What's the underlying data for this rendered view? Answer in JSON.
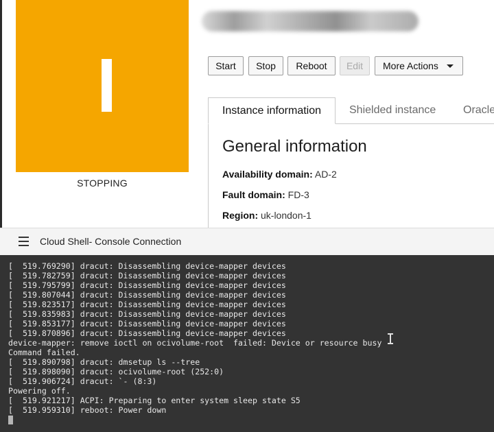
{
  "instance": {
    "letter": "I",
    "status": "STOPPING",
    "tile_color": "#f5a600"
  },
  "actions": {
    "start": "Start",
    "stop": "Stop",
    "reboot": "Reboot",
    "edit": "Edit",
    "more": "More Actions"
  },
  "tabs": [
    {
      "label": "Instance information",
      "active": true
    },
    {
      "label": "Shielded instance",
      "active": false
    },
    {
      "label": "Oracle",
      "active": false
    }
  ],
  "general": {
    "title": "General information",
    "fields": [
      {
        "label": "Availability domain:",
        "value": "AD-2"
      },
      {
        "label": "Fault domain:",
        "value": "FD-3"
      },
      {
        "label": "Region:",
        "value": "uk-london-1"
      }
    ]
  },
  "cloud_shell": {
    "title": "Cloud Shell- Console Connection",
    "menu_icon": "hamburger-menu-icon"
  },
  "terminal": {
    "lines": [
      "[  519.769290] dracut: Disassembling device-mapper devices",
      "[  519.782759] dracut: Disassembling device-mapper devices",
      "[  519.795799] dracut: Disassembling device-mapper devices",
      "[  519.807044] dracut: Disassembling device-mapper devices",
      "[  519.823517] dracut: Disassembling device-mapper devices",
      "[  519.835983] dracut: Disassembling device-mapper devices",
      "[  519.853177] dracut: Disassembling device-mapper devices",
      "[  519.870896] dracut: Disassembling device-mapper devices",
      "device-mapper: remove ioctl on ocivolume-root  failed: Device or resource busy",
      "Command failed.",
      "[  519.890798] dracut: dmsetup ls --tree",
      "[  519.898090] dracut: ocivolume-root (252:0)",
      "[  519.906724] dracut: `- (8:3)",
      "Powering off.",
      "[  519.921217] ACPI: Preparing to enter system sleep state S5",
      "[  519.959310] reboot: Power down"
    ]
  }
}
